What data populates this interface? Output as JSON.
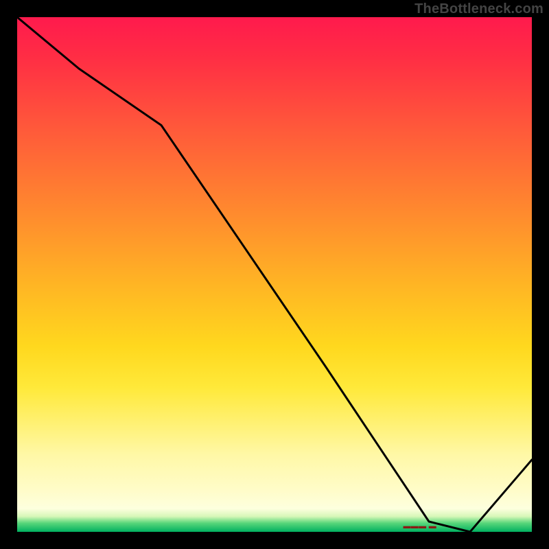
{
  "attribution": "TheBottleneck.com",
  "baseline_marker": "▬▬▬ ▬",
  "chart_data": {
    "type": "line",
    "title": "",
    "xlabel": "",
    "ylabel": "",
    "xlim": [
      0,
      100
    ],
    "ylim": [
      0,
      100
    ],
    "series": [
      {
        "name": "curve",
        "x": [
          0,
          12,
          28,
          60,
          80,
          88,
          100
        ],
        "y": [
          100,
          90,
          79,
          32,
          2,
          0,
          14
        ]
      }
    ],
    "gradient_stops": [
      {
        "pos": 0.0,
        "color": "#ff1a4d"
      },
      {
        "pos": 0.5,
        "color": "#ffb524"
      },
      {
        "pos": 0.85,
        "color": "#fff8a6"
      },
      {
        "pos": 1.0,
        "color": "#00b060"
      }
    ],
    "baseline_marker_x_pct": 79
  }
}
